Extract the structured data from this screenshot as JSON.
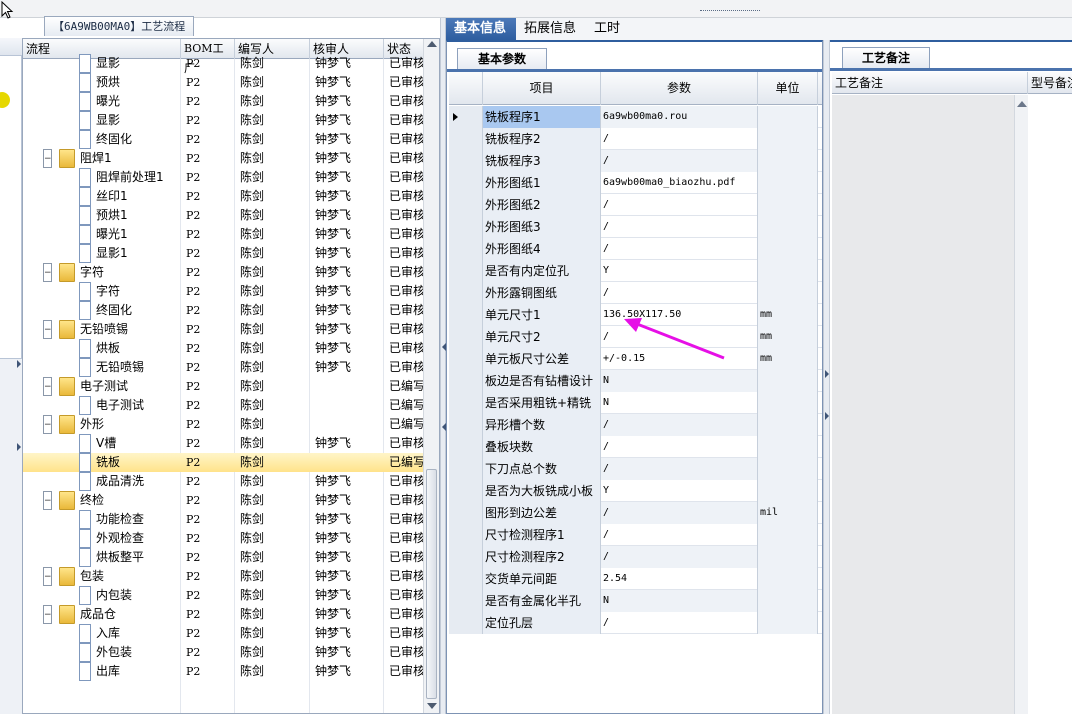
{
  "tree_panel": {
    "title": "【6A9WB00MA0】工艺流程",
    "columns": [
      "流程",
      "BOM工厂",
      "编写人",
      "核审人",
      "状态"
    ],
    "rows": [
      {
        "level": 2,
        "kind": "doc",
        "name": "显影",
        "bom": "P2",
        "writer": "陈剑",
        "reviewer": "钟梦飞",
        "status": "已审核"
      },
      {
        "level": 2,
        "kind": "doc",
        "name": "预烘",
        "bom": "P2",
        "writer": "陈剑",
        "reviewer": "钟梦飞",
        "status": "已审核"
      },
      {
        "level": 2,
        "kind": "doc",
        "name": "曝光",
        "bom": "P2",
        "writer": "陈剑",
        "reviewer": "钟梦飞",
        "status": "已审核"
      },
      {
        "level": 2,
        "kind": "doc",
        "name": "显影",
        "bom": "P2",
        "writer": "陈剑",
        "reviewer": "钟梦飞",
        "status": "已审核"
      },
      {
        "level": 2,
        "kind": "doc",
        "name": "终固化",
        "bom": "P2",
        "writer": "陈剑",
        "reviewer": "钟梦飞",
        "status": "已审核"
      },
      {
        "level": 1,
        "kind": "folder",
        "name": "阻焊1",
        "bom": "P2",
        "writer": "陈剑",
        "reviewer": "钟梦飞",
        "status": "已审核"
      },
      {
        "level": 2,
        "kind": "doc",
        "name": "阻焊前处理1",
        "bom": "P2",
        "writer": "陈剑",
        "reviewer": "钟梦飞",
        "status": "已审核"
      },
      {
        "level": 2,
        "kind": "doc",
        "name": "丝印1",
        "bom": "P2",
        "writer": "陈剑",
        "reviewer": "钟梦飞",
        "status": "已审核"
      },
      {
        "level": 2,
        "kind": "doc",
        "name": "预烘1",
        "bom": "P2",
        "writer": "陈剑",
        "reviewer": "钟梦飞",
        "status": "已审核"
      },
      {
        "level": 2,
        "kind": "doc",
        "name": "曝光1",
        "bom": "P2",
        "writer": "陈剑",
        "reviewer": "钟梦飞",
        "status": "已审核"
      },
      {
        "level": 2,
        "kind": "doc",
        "name": "显影1",
        "bom": "P2",
        "writer": "陈剑",
        "reviewer": "钟梦飞",
        "status": "已审核"
      },
      {
        "level": 1,
        "kind": "folder",
        "name": "字符",
        "bom": "P2",
        "writer": "陈剑",
        "reviewer": "钟梦飞",
        "status": "已审核"
      },
      {
        "level": 2,
        "kind": "doc",
        "name": "字符",
        "bom": "P2",
        "writer": "陈剑",
        "reviewer": "钟梦飞",
        "status": "已审核"
      },
      {
        "level": 2,
        "kind": "doc",
        "name": "终固化",
        "bom": "P2",
        "writer": "陈剑",
        "reviewer": "钟梦飞",
        "status": "已审核"
      },
      {
        "level": 1,
        "kind": "folder",
        "name": "无铅喷锡",
        "bom": "P2",
        "writer": "陈剑",
        "reviewer": "钟梦飞",
        "status": "已审核"
      },
      {
        "level": 2,
        "kind": "doc",
        "name": "烘板",
        "bom": "P2",
        "writer": "陈剑",
        "reviewer": "钟梦飞",
        "status": "已审核"
      },
      {
        "level": 2,
        "kind": "doc",
        "name": "无铅喷锡",
        "bom": "P2",
        "writer": "陈剑",
        "reviewer": "钟梦飞",
        "status": "已审核"
      },
      {
        "level": 1,
        "kind": "folder",
        "name": "电子测试",
        "bom": "P2",
        "writer": "陈剑",
        "reviewer": "",
        "status": "已编写"
      },
      {
        "level": 2,
        "kind": "doc",
        "name": "电子测试",
        "bom": "P2",
        "writer": "陈剑",
        "reviewer": "",
        "status": "已编写"
      },
      {
        "level": 1,
        "kind": "folder",
        "name": "外形",
        "bom": "P2",
        "writer": "陈剑",
        "reviewer": "",
        "status": "已编写"
      },
      {
        "level": 2,
        "kind": "doc",
        "name": "V槽",
        "bom": "P2",
        "writer": "陈剑",
        "reviewer": "钟梦飞",
        "status": "已审核"
      },
      {
        "level": 2,
        "kind": "doc",
        "name": "铣板",
        "bom": "P2",
        "writer": "陈剑",
        "reviewer": "",
        "status": "已编写",
        "selected": true
      },
      {
        "level": 2,
        "kind": "doc",
        "name": "成品清洗",
        "bom": "P2",
        "writer": "陈剑",
        "reviewer": "钟梦飞",
        "status": "已审核"
      },
      {
        "level": 1,
        "kind": "folder",
        "name": "终检",
        "bom": "P2",
        "writer": "陈剑",
        "reviewer": "钟梦飞",
        "status": "已审核"
      },
      {
        "level": 2,
        "kind": "doc",
        "name": "功能检查",
        "bom": "P2",
        "writer": "陈剑",
        "reviewer": "钟梦飞",
        "status": "已审核"
      },
      {
        "level": 2,
        "kind": "doc",
        "name": "外观检查",
        "bom": "P2",
        "writer": "陈剑",
        "reviewer": "钟梦飞",
        "status": "已审核"
      },
      {
        "level": 2,
        "kind": "doc",
        "name": "烘板整平",
        "bom": "P2",
        "writer": "陈剑",
        "reviewer": "钟梦飞",
        "status": "已审核"
      },
      {
        "level": 1,
        "kind": "folder",
        "name": "包装",
        "bom": "P2",
        "writer": "陈剑",
        "reviewer": "钟梦飞",
        "status": "已审核"
      },
      {
        "level": 2,
        "kind": "doc",
        "name": "内包装",
        "bom": "P2",
        "writer": "陈剑",
        "reviewer": "钟梦飞",
        "status": "已审核"
      },
      {
        "level": 1,
        "kind": "folder",
        "name": "成品仓",
        "bom": "P2",
        "writer": "陈剑",
        "reviewer": "钟梦飞",
        "status": "已审核"
      },
      {
        "level": 2,
        "kind": "doc",
        "name": "入库",
        "bom": "P2",
        "writer": "陈剑",
        "reviewer": "钟梦飞",
        "status": "已审核"
      },
      {
        "level": 2,
        "kind": "doc",
        "name": "外包装",
        "bom": "P2",
        "writer": "陈剑",
        "reviewer": "钟梦飞",
        "status": "已审核"
      },
      {
        "level": 2,
        "kind": "doc",
        "name": "出库",
        "bom": "P2",
        "writer": "陈剑",
        "reviewer": "钟梦飞",
        "status": "已审核"
      }
    ]
  },
  "main_tabs": [
    {
      "label": "基本信息",
      "active": true
    },
    {
      "label": "拓展信息",
      "active": false
    },
    {
      "label": "工时",
      "active": false
    }
  ],
  "params_panel": {
    "subtab": "基本参数",
    "columns": [
      "项目",
      "参数",
      "单位"
    ],
    "rows": [
      {
        "item": "铣板程序1",
        "param": "6a9wb00ma0.rou",
        "unit": "",
        "selected": true
      },
      {
        "item": "铣板程序2",
        "param": "/",
        "unit": ""
      },
      {
        "item": "铣板程序3",
        "param": "/",
        "unit": ""
      },
      {
        "item": "外形图纸1",
        "param": "6a9wb00ma0_biaozhu.pdf",
        "unit": ""
      },
      {
        "item": "外形图纸2",
        "param": "/",
        "unit": ""
      },
      {
        "item": "外形图纸3",
        "param": "/",
        "unit": ""
      },
      {
        "item": "外形图纸4",
        "param": "/",
        "unit": ""
      },
      {
        "item": "是否有内定位孔",
        "param": "Y",
        "unit": ""
      },
      {
        "item": "外形露铜图纸",
        "param": "/",
        "unit": ""
      },
      {
        "item": "单元尺寸1",
        "param": "136.50X117.50",
        "unit": "mm"
      },
      {
        "item": "单元尺寸2",
        "param": "/",
        "unit": "mm"
      },
      {
        "item": "单元板尺寸公差",
        "param": "+/-0.15",
        "unit": "mm"
      },
      {
        "item": "板边是否有钻槽设计",
        "param": "N",
        "unit": ""
      },
      {
        "item": "是否采用粗铣+精铣",
        "param": "N",
        "unit": ""
      },
      {
        "item": "异形槽个数",
        "param": "/",
        "unit": ""
      },
      {
        "item": "叠板块数",
        "param": "/",
        "unit": ""
      },
      {
        "item": "下刀点总个数",
        "param": "/",
        "unit": ""
      },
      {
        "item": "是否为大板铣成小板",
        "param": "Y",
        "unit": ""
      },
      {
        "item": "图形到边公差",
        "param": "/",
        "unit": "mil"
      },
      {
        "item": "尺寸检测程序1",
        "param": "/",
        "unit": ""
      },
      {
        "item": "尺寸检测程序2",
        "param": "/",
        "unit": ""
      },
      {
        "item": "交货单元间距",
        "param": "2.54",
        "unit": ""
      },
      {
        "item": "是否有金属化半孔",
        "param": "N",
        "unit": ""
      },
      {
        "item": "定位孔层",
        "param": "/",
        "unit": ""
      }
    ]
  },
  "notes_panel": {
    "tab": "工艺备注",
    "columns": [
      "工艺备注",
      "型号备注"
    ]
  },
  "colors": {
    "accent": "#2f5e9e",
    "selected_row": "#ffe38a",
    "annotation_arrow": "#e60fe6"
  }
}
